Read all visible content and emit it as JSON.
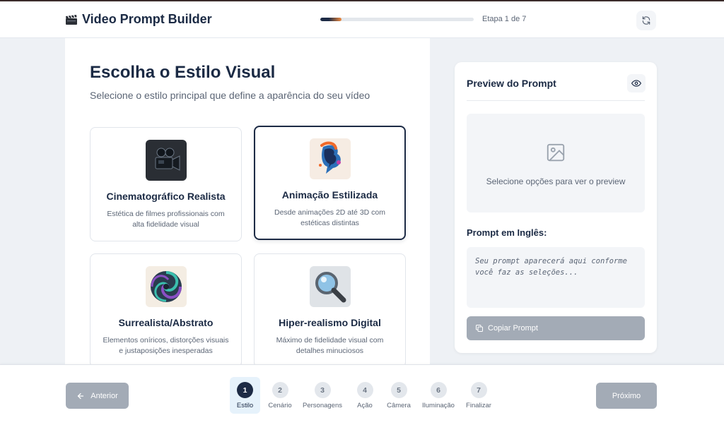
{
  "header": {
    "app_title": "Video Prompt Builder",
    "step_text": "Etapa 1 de 7",
    "progress_fraction": 0.14
  },
  "main": {
    "title": "Escolha o Estilo Visual",
    "subtitle": "Selecione o estilo principal que define a aparência do seu vídeo",
    "cards": [
      {
        "title": "Cinematográfico Realista",
        "desc": "Estética de filmes profissionais com alta fidelidade visual",
        "icon": "film-camera-icon",
        "selected": false
      },
      {
        "title": "Animação Estilizada",
        "desc": "Desde animações 2D até 3D com estéticas distintas",
        "icon": "animation-b-icon",
        "selected": true
      },
      {
        "title": "Surrealista/Abstrato",
        "desc": "Elementos oníricos, distorções visuais e justaposições inesperadas",
        "icon": "spiral-icon",
        "selected": false
      },
      {
        "title": "Hiper-realismo Digital",
        "desc": "Máximo de fidelidade visual com detalhes minuciosos",
        "icon": "magnifier-icon",
        "selected": false
      }
    ]
  },
  "preview": {
    "title": "Preview do Prompt",
    "empty_message": "Selecione opções para ver o preview",
    "prompt_label": "Prompt em Inglês:",
    "prompt_placeholder": "Seu prompt aparecerá aqui conforme você faz as seleções...",
    "copy_label": "Copiar Prompt"
  },
  "footer": {
    "prev_label": "Anterior",
    "next_label": "Próximo",
    "steps": [
      {
        "number": "1",
        "label": "Estilo",
        "active": true
      },
      {
        "number": "2",
        "label": "Cenário",
        "active": false
      },
      {
        "number": "3",
        "label": "Personagens",
        "active": false
      },
      {
        "number": "4",
        "label": "Ação",
        "active": false
      },
      {
        "number": "5",
        "label": "Câmera",
        "active": false
      },
      {
        "number": "6",
        "label": "Iluminação",
        "active": false
      },
      {
        "number": "7",
        "label": "Finalizar",
        "active": false
      }
    ]
  },
  "colors": {
    "accent": "#1d2b45",
    "progress_end": "#f08a3e",
    "disabled_button": "#a3abb6",
    "active_step_bg": "#e6f2fb"
  }
}
